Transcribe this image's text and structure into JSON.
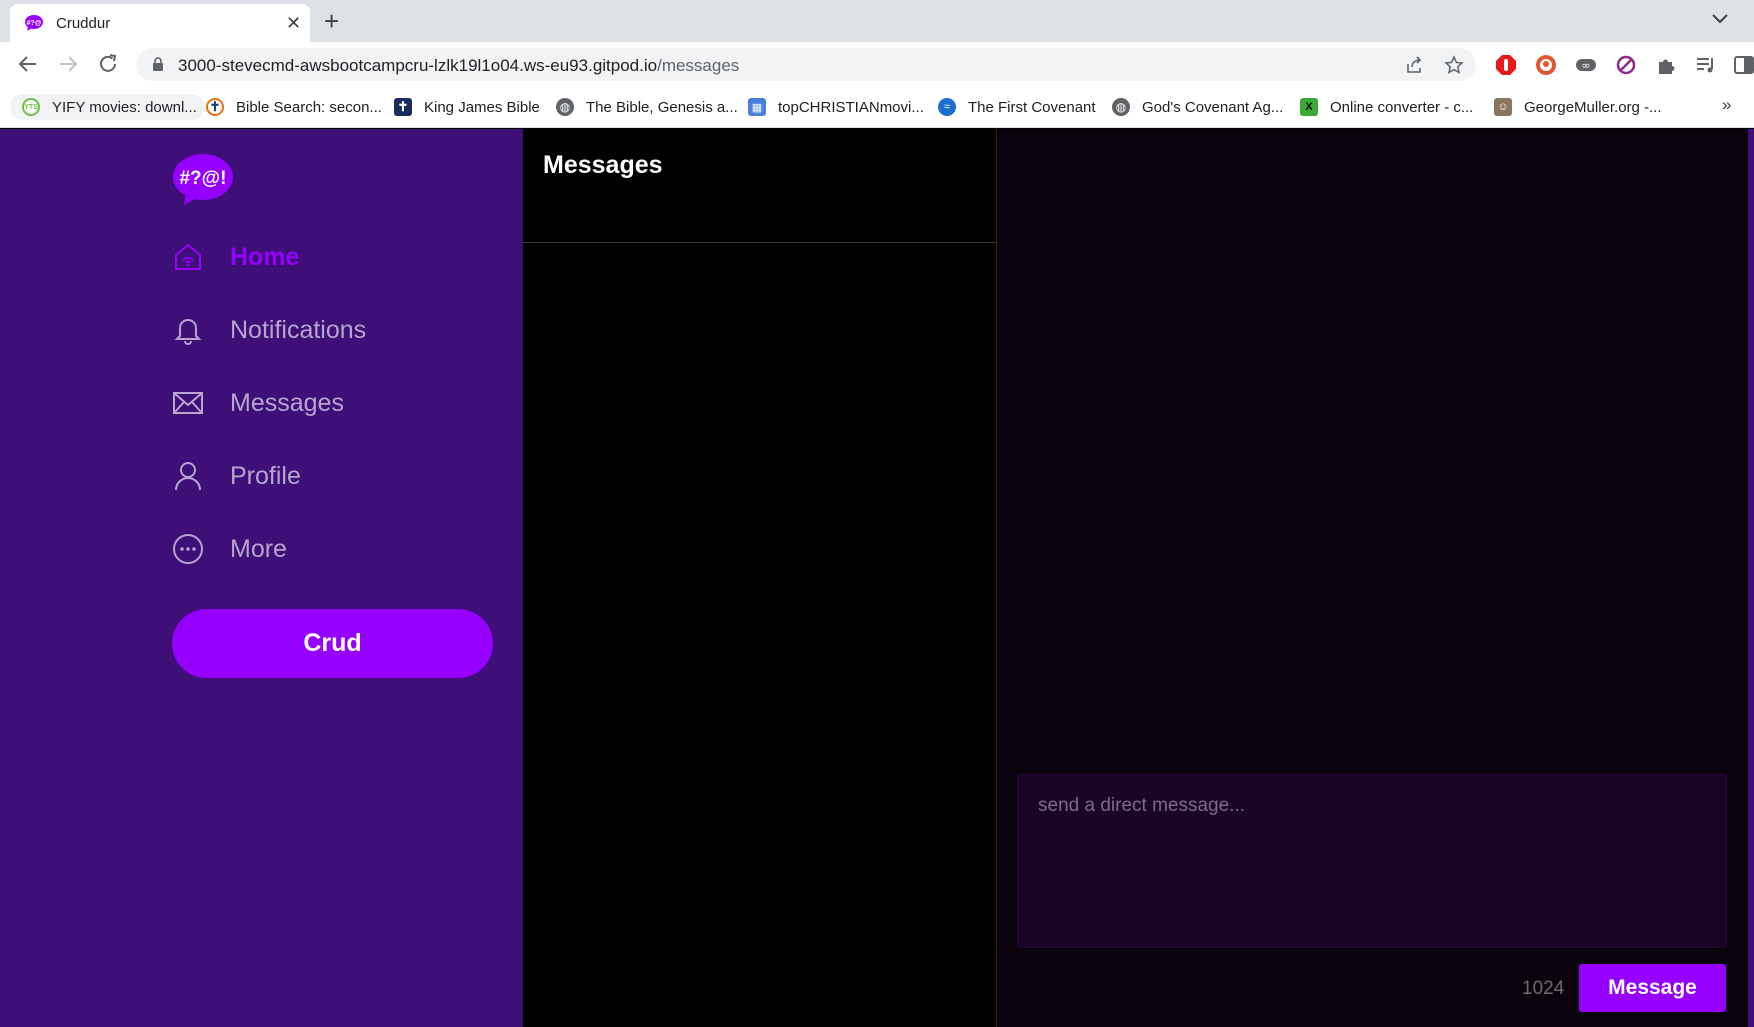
{
  "browser": {
    "tab_title": "Cruddur",
    "url_host": "3000-stevecmd-awsbootcampcru-lzlk19l1o04.ws-eu93.gitpod.io",
    "url_path": "/messages",
    "bookmarks": [
      {
        "label": "YIFY movies: downl...",
        "icon": "yify-icon"
      },
      {
        "label": "Bible Search: secon...",
        "icon": "cross-icon"
      },
      {
        "label": "King James Bible",
        "icon": "cross-icon"
      },
      {
        "label": "The Bible, Genesis a...",
        "icon": "globe-icon"
      },
      {
        "label": "topCHRISTIANmovi...",
        "icon": "film-icon"
      },
      {
        "label": "The First Covenant",
        "icon": "covenant-icon"
      },
      {
        "label": "God's Covenant Ag...",
        "icon": "globe-icon"
      },
      {
        "label": "Online converter - c...",
        "icon": "converter-icon"
      },
      {
        "label": "GeorgeMuller.org -...",
        "icon": "portrait-icon"
      }
    ],
    "bookmarks_more": "»"
  },
  "sidebar": {
    "logo": "#?@!",
    "items": [
      {
        "label": "Home",
        "icon": "home-icon",
        "active": true
      },
      {
        "label": "Notifications",
        "icon": "bell-icon"
      },
      {
        "label": "Messages",
        "icon": "envelope-icon"
      },
      {
        "label": "Profile",
        "icon": "person-icon"
      },
      {
        "label": "More",
        "icon": "more-icon"
      }
    ],
    "crud_label": "Crud"
  },
  "messages": {
    "title": "Messages"
  },
  "conversation": {
    "input_placeholder": "send a direct message...",
    "char_count": "1024",
    "send_label": "Message"
  },
  "colors": {
    "sidebar_bg": "#3e0f77",
    "accent": "#9500ff",
    "input_bg": "#1a0527"
  }
}
